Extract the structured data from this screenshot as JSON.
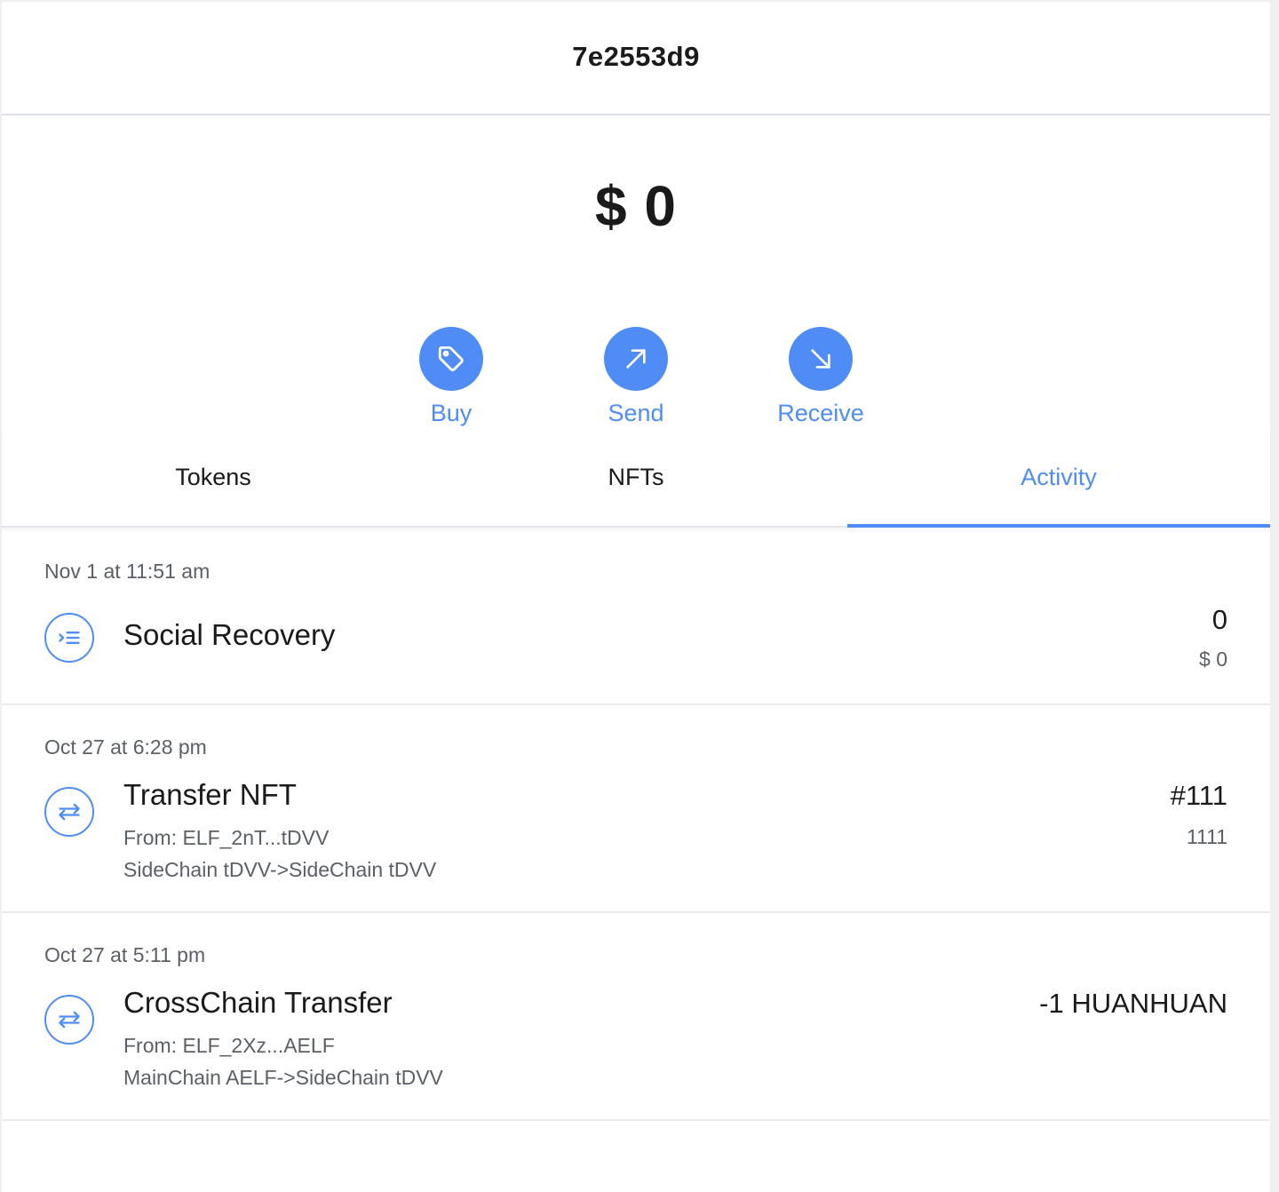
{
  "header": {
    "title": "7e2553d9"
  },
  "balance": {
    "amount": "$ 0"
  },
  "actions": [
    {
      "label": "Buy",
      "icon": "tag-icon"
    },
    {
      "label": "Send",
      "icon": "arrow-up-right-icon"
    },
    {
      "label": "Receive",
      "icon": "arrow-down-right-icon"
    }
  ],
  "tabs": [
    {
      "label": "Tokens",
      "active": false
    },
    {
      "label": "NFTs",
      "active": false
    },
    {
      "label": "Activity",
      "active": true
    }
  ],
  "activity": [
    {
      "date": "Nov 1 at 11:51 am",
      "icon": "social-recovery-icon",
      "name": "Social Recovery",
      "amount": "0",
      "amount_sub": "$ 0"
    },
    {
      "date": "Oct 27 at 6:28 pm",
      "icon": "transfer-icon",
      "name": "Transfer NFT",
      "from": "From: ELF_2nT...tDVV",
      "route": "SideChain tDVV->SideChain tDVV",
      "amount": "#111",
      "amount_sub": "1111"
    },
    {
      "date": "Oct 27 at 5:11 pm",
      "icon": "transfer-icon",
      "name": "CrossChain Transfer",
      "from": "From: ELF_2Xz...AELF",
      "route": "MainChain AELF->SideChain tDVV",
      "amount": "-1 HUANHUAN"
    }
  ],
  "colors": {
    "accent": "#4f8cf5",
    "text": "#1a1a1a",
    "muted": "#5b5f66"
  }
}
